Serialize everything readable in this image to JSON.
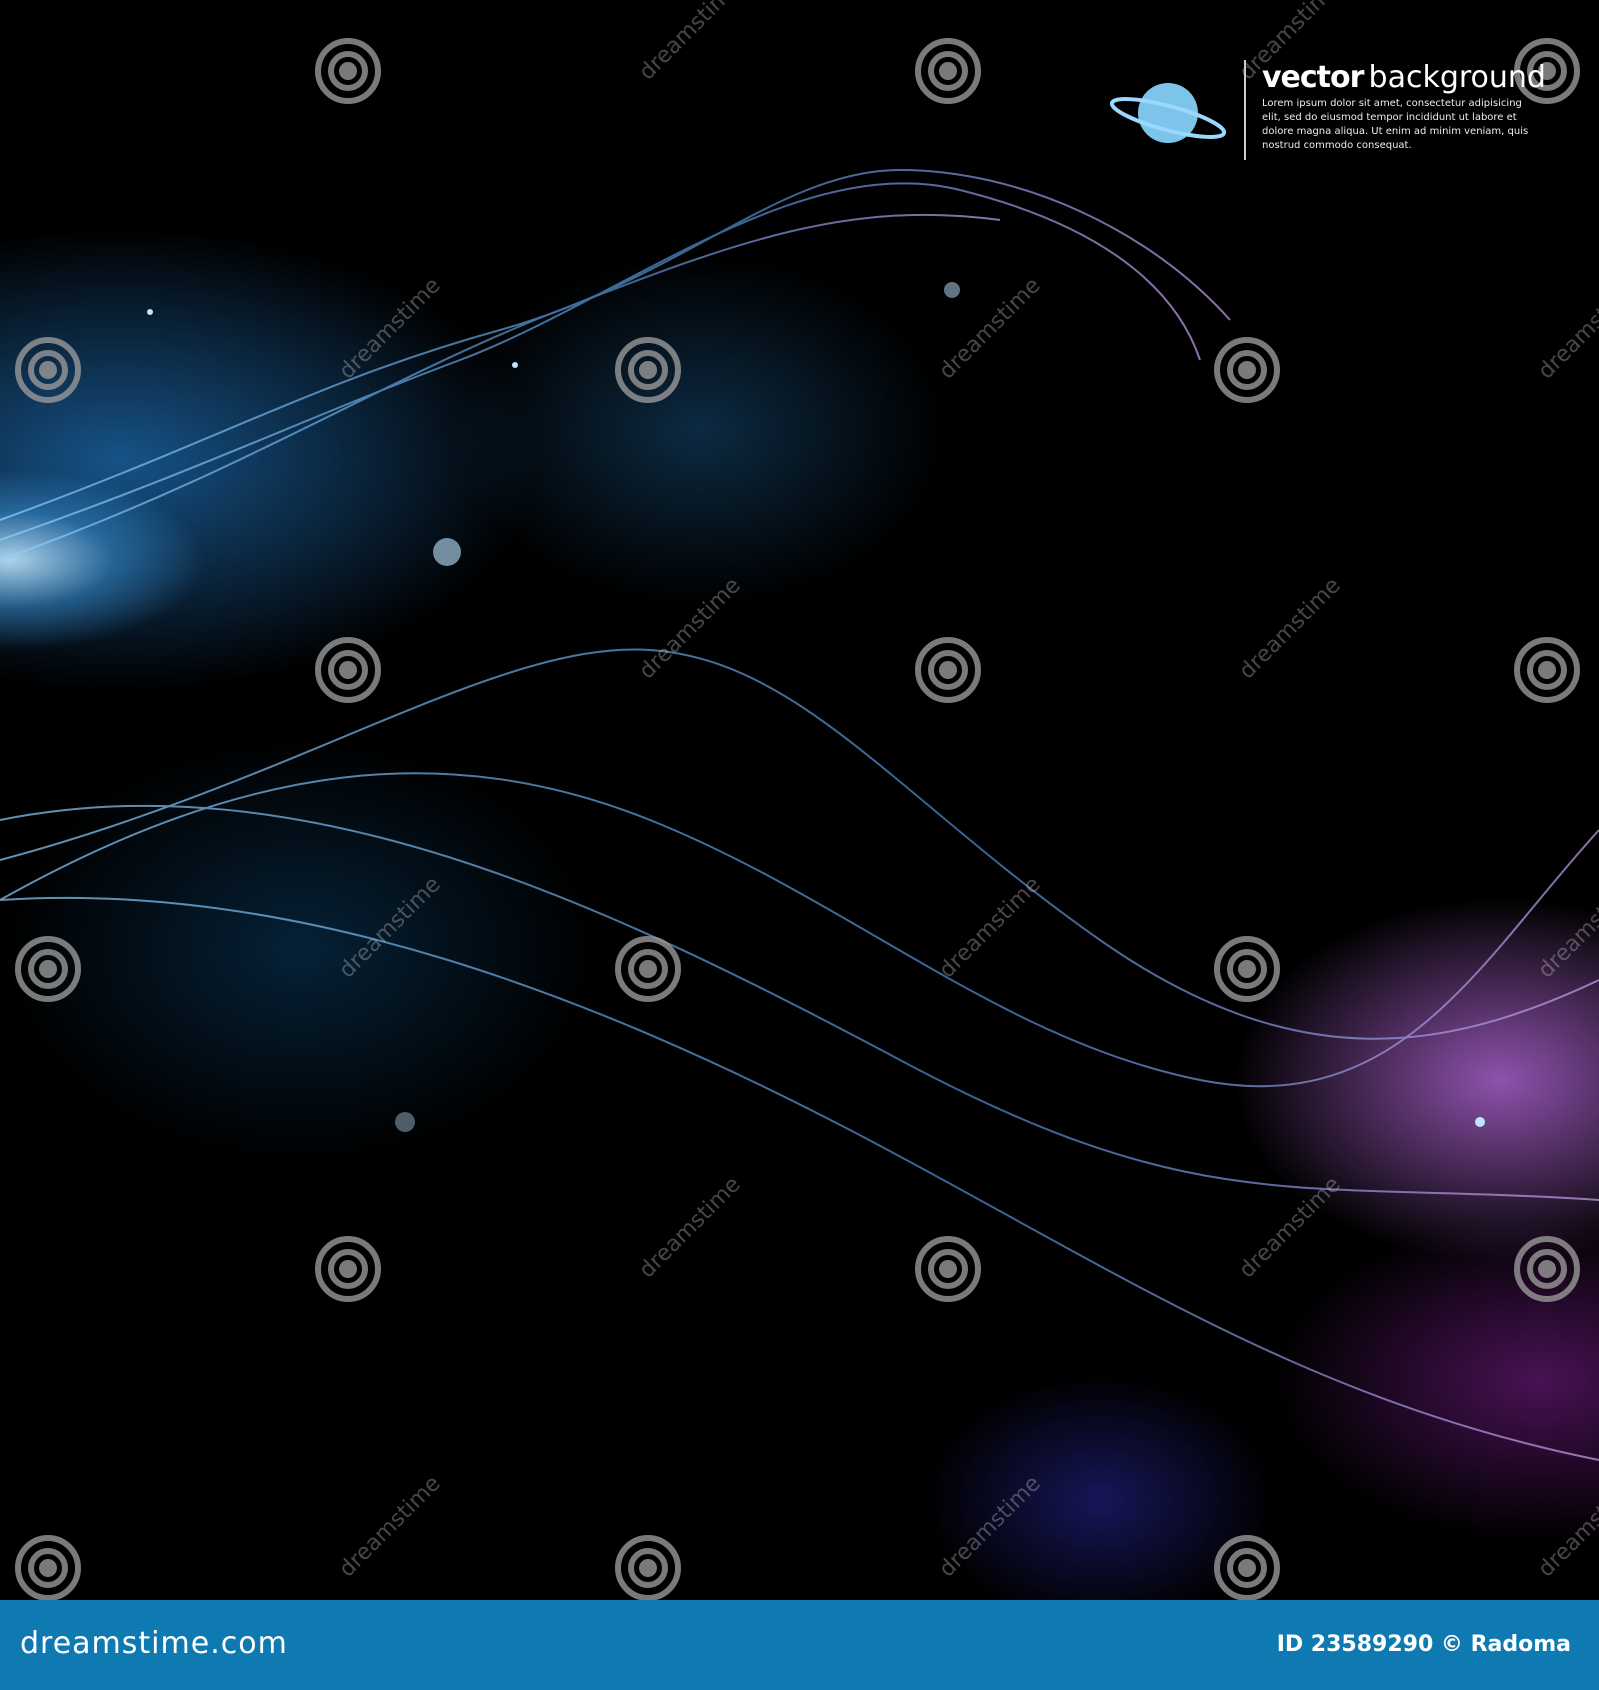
{
  "headline": {
    "bold": "vector",
    "regular": "background",
    "body": "Lorem ipsum dolor sit amet, consectetur adipisicing elit, sed do eiusmod tempor incididunt ut labore et dolore magna aliqua. Ut enim ad minim veniam, quis nostrud commodo consequat."
  },
  "watermark": {
    "text": "dreamstime"
  },
  "footer": {
    "logo": "dreamstime.com",
    "credit": "ID 23589290 © Radoma",
    "background": "#0f7ab2"
  }
}
